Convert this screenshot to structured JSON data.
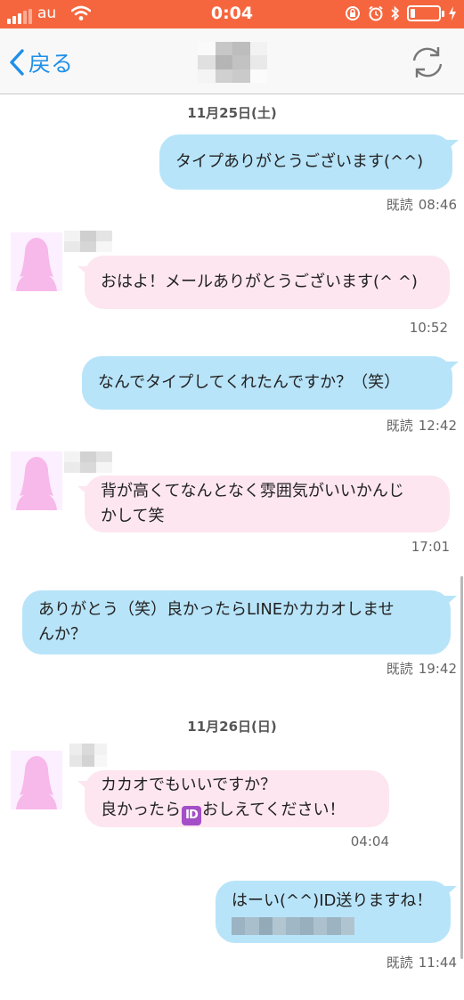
{
  "status_bar": {
    "carrier": "au",
    "time": "0:04",
    "icons": [
      "signal-icon",
      "wifi-icon",
      "rotation-lock-icon",
      "alarm-icon",
      "bluetooth-icon",
      "battery-icon",
      "charging-icon"
    ],
    "battery_level": 0.15,
    "background_color": "#f6663e"
  },
  "nav": {
    "back_label": "戻る",
    "back_icon": "chevron-left-icon",
    "refresh_icon": "refresh-icon",
    "accent_color": "#1f8fe8"
  },
  "chat": {
    "dates": [
      "11月25日(土)",
      "11月26日(日)"
    ],
    "read_label": "既読",
    "messages": [
      {
        "side": "out",
        "lines": [
          "タイプありがとうございます(^^)"
        ],
        "read": "既読",
        "time": "08:46"
      },
      {
        "side": "in",
        "lines": [
          "おはよ！メールありがとうございます(^ ^)"
        ],
        "time": "10:52"
      },
      {
        "side": "out",
        "lines": [
          "なんでタイプしてくれたんですか？（笑）"
        ],
        "read": "既読",
        "time": "12:42"
      },
      {
        "side": "in",
        "lines": [
          "背が高くてなんとなく雰囲気がいいかんじ",
          "かして笑"
        ],
        "time": "17:01"
      },
      {
        "side": "out",
        "lines": [
          "ありがとう（笑）良かったらLINEかカカオしませ",
          "んか？"
        ],
        "read": "既読",
        "time": "19:42"
      },
      {
        "side": "in",
        "lines": [
          "カカオでもいいですか？",
          "良かったら",
          "おしえてください！"
        ],
        "badge": "ID",
        "time": "04:04"
      },
      {
        "side": "out",
        "lines": [
          "はーい(^^)ID送りますね！"
        ],
        "read": "既読",
        "time": "11:44"
      }
    ],
    "colors": {
      "outgoing": "#b8e4f9",
      "incoming": "#fde6f0",
      "avatar": "#f7b8ea"
    }
  }
}
